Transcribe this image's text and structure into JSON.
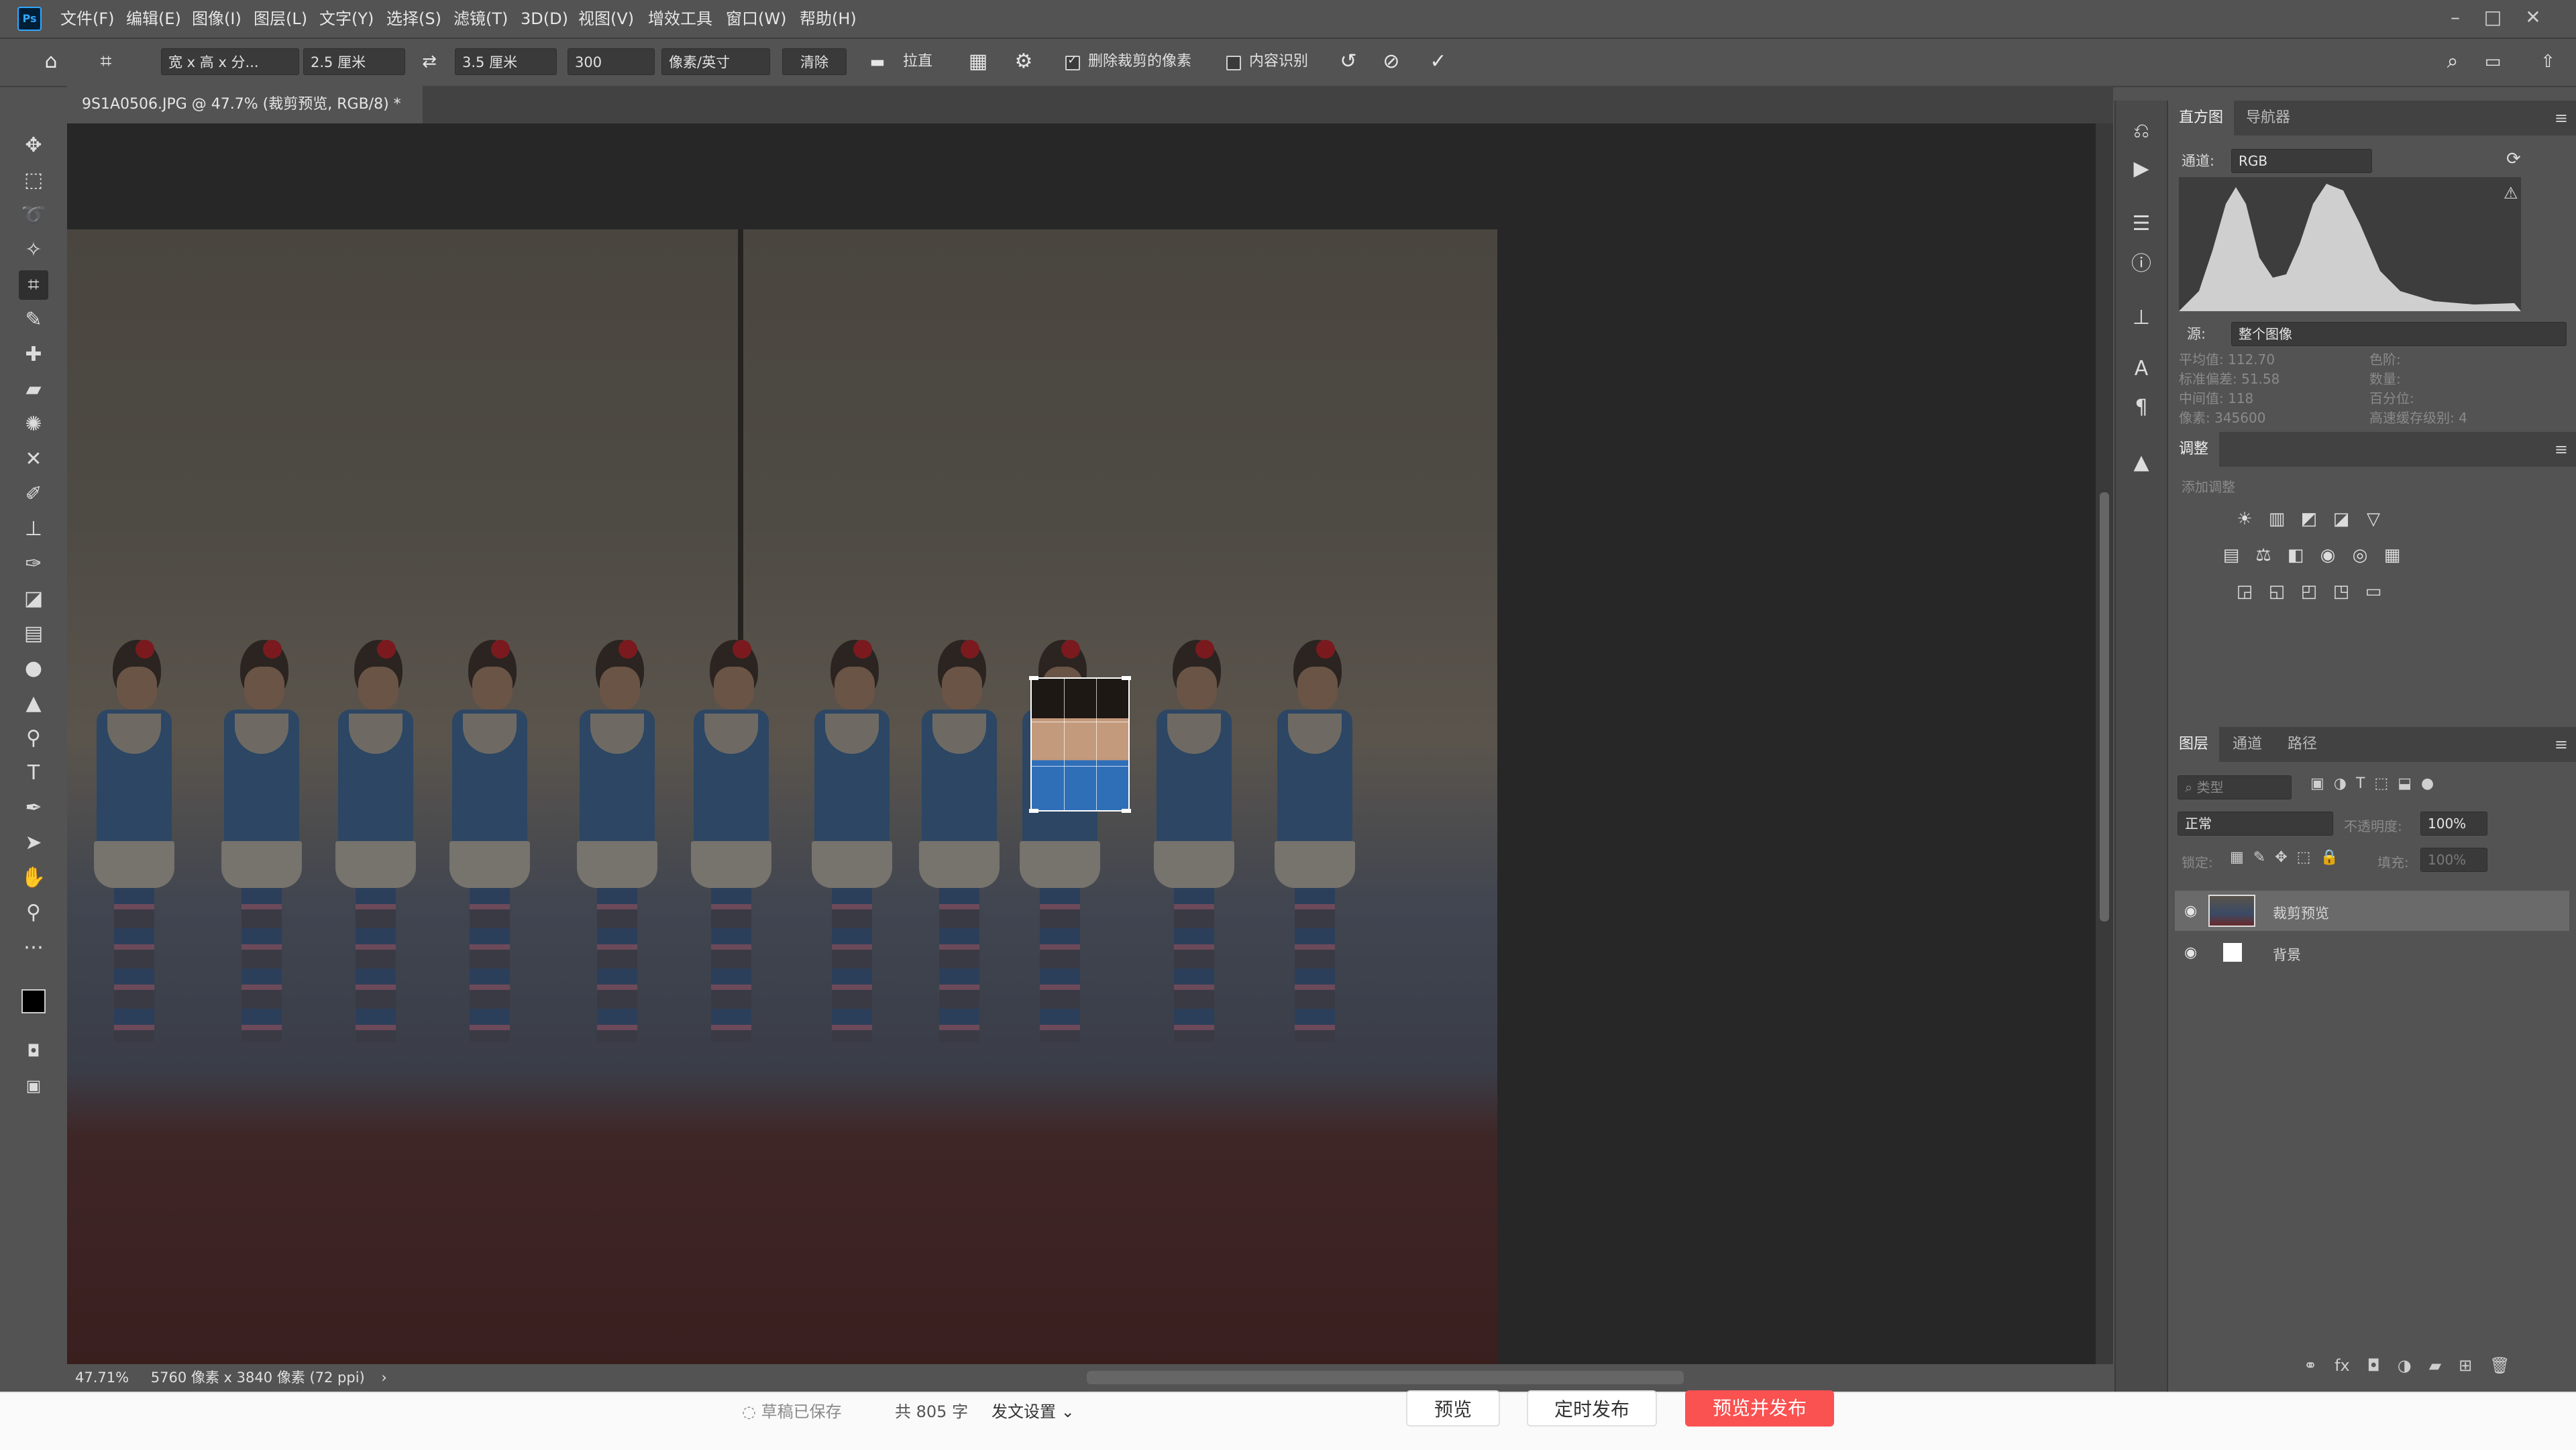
{
  "menubar": {
    "logo": "Ps",
    "items": [
      "文件(F)",
      "编辑(E)",
      "图像(I)",
      "图层(L)",
      "文字(Y)",
      "选择(S)",
      "滤镜(T)",
      "3D(D)",
      "视图(V)",
      "增效工具",
      "窗口(W)",
      "帮助(H)"
    ],
    "minimize": "–",
    "maximize": "□",
    "close": "✕"
  },
  "options": {
    "ratio_preset": "宽 x 高 x 分...",
    "width": "2.5 厘米",
    "height": "3.5 厘米",
    "resolution": "300",
    "resolution_unit": "像素/英寸",
    "clear_label": "清除",
    "straighten_label": "拉直",
    "delete_cropped_label": "删除裁剪的像素",
    "delete_cropped_checked": true,
    "content_aware_label": "内容识别",
    "content_aware_checked": false
  },
  "document": {
    "tab_title": "9S1A0506.JPG @ 47.7% (裁剪预览, RGB/8) *",
    "close": "×"
  },
  "status": {
    "zoom": "47.71%",
    "info": "5760 像素 x 3840 像素 (72 ppi)"
  },
  "histogram": {
    "tabs": [
      "直方图",
      "导航器"
    ],
    "channel_label": "通道:",
    "channel": "RGB",
    "source_label": "源:",
    "source": "整个图像",
    "stats_left": [
      {
        "label": "平均值:",
        "value": "112.70"
      },
      {
        "label": "标准偏差:",
        "value": "51.58"
      },
      {
        "label": "中间值:",
        "value": "118"
      },
      {
        "label": "像素:",
        "value": "345600"
      }
    ],
    "stats_right": [
      {
        "label": "色阶:",
        "value": ""
      },
      {
        "label": "数量:",
        "value": ""
      },
      {
        "label": "百分位:",
        "value": ""
      },
      {
        "label": "高速缓存级别:",
        "value": "4"
      }
    ]
  },
  "adjustments": {
    "title": "调整",
    "subtitle": "添加调整",
    "row1": [
      "☀",
      "▥",
      "◩",
      "◪",
      "▽"
    ],
    "row2": [
      "▤",
      "⚖",
      "◧",
      "◉",
      "◎",
      "▦"
    ],
    "row3": [
      "◲",
      "◱",
      "◰",
      "◳",
      "▭"
    ]
  },
  "layers": {
    "tabs": [
      "图层",
      "通道",
      "路径"
    ],
    "kind_placeholder": "类型",
    "blend_mode": "正常",
    "opacity_label": "不透明度:",
    "opacity": "100%",
    "lock_label": "锁定:",
    "fill_label": "填充:",
    "fill": "100%",
    "items": [
      {
        "name": "裁剪预览",
        "visible": true,
        "selected": true
      },
      {
        "name": "背景",
        "visible": true,
        "selected": false
      }
    ],
    "footer_icons": [
      "link-icon",
      "fx-icon",
      "mask-icon",
      "adjustment-icon",
      "folder-icon",
      "new-layer-icon",
      "trash-icon"
    ]
  },
  "footer": {
    "saved": "草稿已保存",
    "word_count": "共 805 字",
    "settings": "发文设置",
    "preview": "预览",
    "schedule": "定时发布",
    "publish": "预览并发布"
  },
  "colors": {
    "accent": "#31a8ff",
    "publish_button": "#fa5151",
    "panel_bg": "#535353",
    "canvas_bg": "#272727"
  }
}
